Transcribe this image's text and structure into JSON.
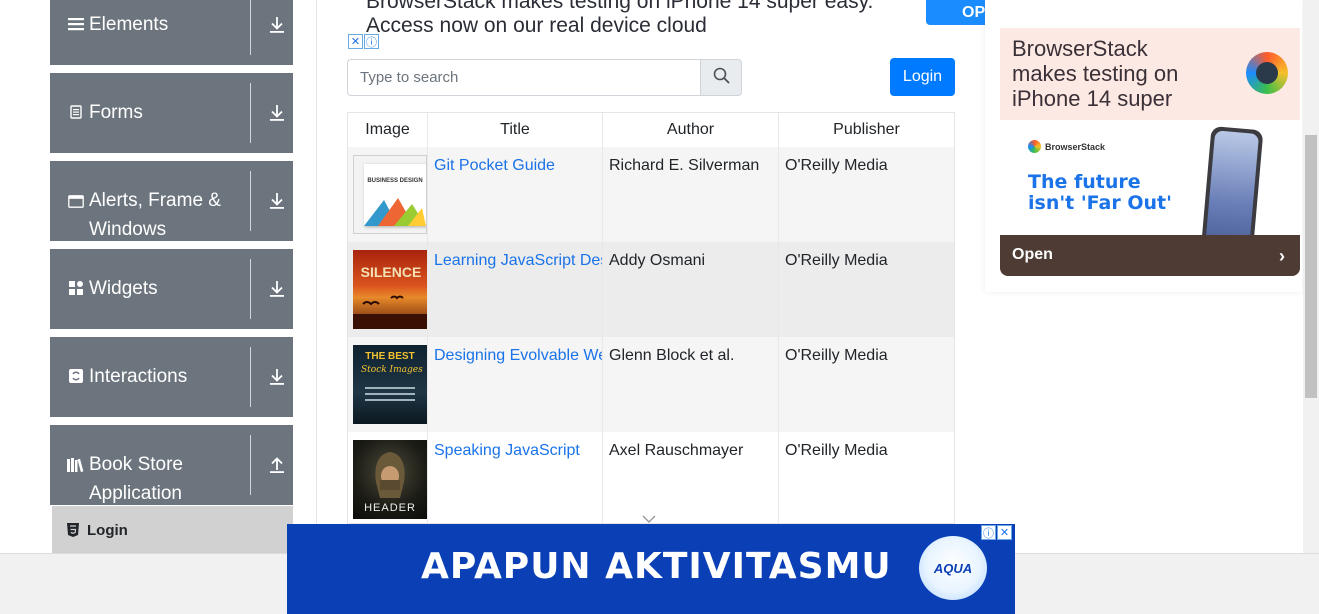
{
  "sidebar": {
    "groups": [
      {
        "label": "Elements",
        "icon": "hamburger-icon",
        "arrow": "download-arrow-icon"
      },
      {
        "label": "Forms",
        "icon": "document-icon",
        "arrow": "download-arrow-icon"
      },
      {
        "label": "Alerts, Frame &",
        "label2": "Windows",
        "icon": "window-icon",
        "arrow": "download-arrow-icon"
      },
      {
        "label": "Widgets",
        "icon": "grid-icon",
        "arrow": "download-arrow-icon"
      },
      {
        "label": "Interactions",
        "icon": "interaction-icon",
        "arrow": "download-arrow-icon"
      },
      {
        "label": "Book Store",
        "label2": "Application",
        "icon": "books-icon",
        "arrow": "upload-arrow-icon"
      }
    ],
    "active_item": {
      "label": "Login"
    }
  },
  "top_ad": {
    "text_line1": "BrowserStack makes testing on iPhone 14 super easy.",
    "text_line2": "Access now on our real device cloud",
    "button": "OP"
  },
  "search": {
    "placeholder": "Type to search"
  },
  "login_button": "Login",
  "table": {
    "headers": [
      "Image",
      "Title",
      "Author",
      "Publisher"
    ],
    "rows": [
      {
        "title": "Git Pocket Guide",
        "author": "Richard E. Silverman",
        "publisher": "O'Reilly Media",
        "cover_text": "BUSINESS DESIGN"
      },
      {
        "title": "Learning JavaScript Design Patterns",
        "author": "Addy Osmani",
        "publisher": "O'Reilly Media",
        "cover_text": "SILENCE"
      },
      {
        "title": "Designing Evolvable Web APIs with ASP.NET",
        "author": "Glenn Block et al.",
        "publisher": "O'Reilly Media",
        "cover_text": "THE BEST"
      },
      {
        "title": "Speaking JavaScript",
        "author": "Axel Rauschmayer",
        "publisher": "O'Reilly Media",
        "cover_text": "HEADER"
      }
    ]
  },
  "right_ad": {
    "headline_l1": "BrowserStack",
    "headline_l2": "makes testing on",
    "headline_l3": "iPhone 14 super",
    "brand": "BrowserStack",
    "tagline_l1": "The future",
    "tagline_l2": "isn't 'Far Out'",
    "cta": "Open"
  },
  "bottom_ad": {
    "text": "APAPUN AKTIVITASMU",
    "logo": "AQUA"
  },
  "colors": {
    "sidebar_group": "#6c757d",
    "primary": "#007bff",
    "link": "#1a73e8",
    "bottom_ad": "#0a3fb5"
  }
}
